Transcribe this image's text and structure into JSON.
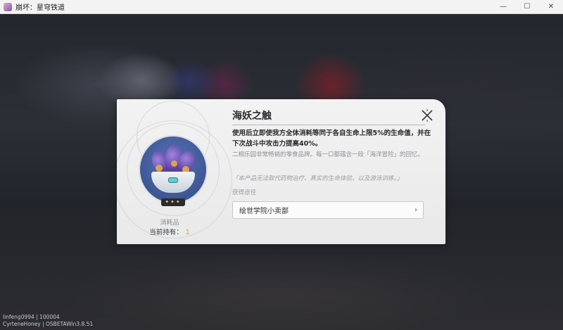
{
  "window": {
    "title": "崩坏：星穹铁道",
    "minimize_glyph": "—",
    "maximize_glyph": "☐",
    "close_glyph": "✕"
  },
  "item": {
    "name": "海妖之触",
    "category": "消耗品",
    "owned_label": "当前持有：",
    "owned_count": "1",
    "rarity_stars": "✦✦✦",
    "effect_description": "使用后立即使我方全体消耗等同于各自生命上限5%的生命值，并在下次战斗中攻击力提高40%。",
    "lore": "二相乐园非常畅销的零食品牌。每一口都蕴含一段「海洋冒险」的回忆。",
    "quote": "「本产品无法取代药物治疗、真实的生命体验、以及游泳训练。」",
    "source_label": "获得途径",
    "source": "绘世学院小卖部",
    "chevron": "›"
  },
  "watermark": {
    "line1": "linfeng0994 | 100004",
    "line2": "CyrteneHoney | OSBETAWin3.8.51"
  },
  "colors": {
    "accent_count": "#e2a024",
    "card_bg": "#f2f2f2",
    "icon_bg": "#4a64a8"
  }
}
